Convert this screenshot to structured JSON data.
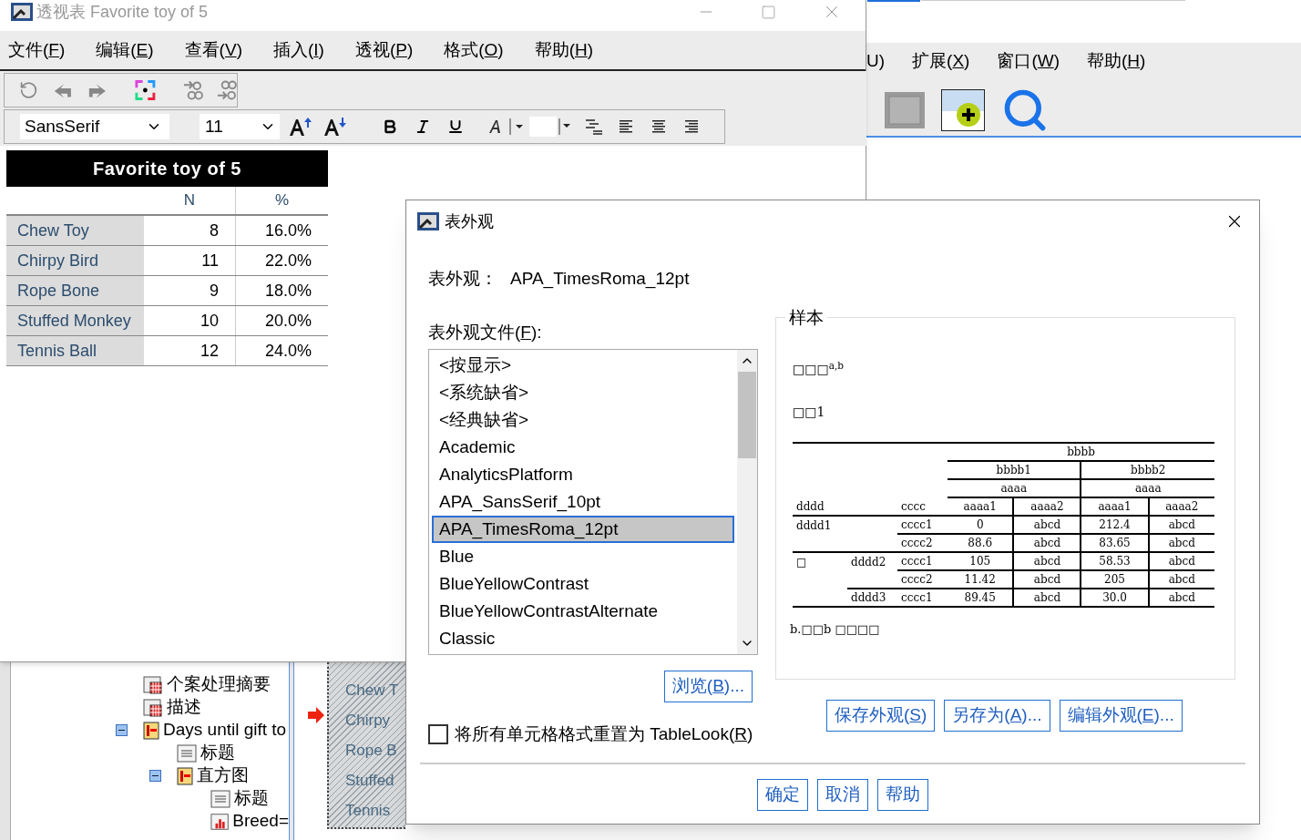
{
  "background_app": {
    "menu": [
      "U)",
      "扩展(X)",
      "窗口(W)",
      "帮助(H)"
    ]
  },
  "outline": {
    "items": [
      {
        "label": "个案处理摘要",
        "kind": "table"
      },
      {
        "label": "描述",
        "kind": "table"
      },
      {
        "label": "Days until gift to",
        "kind": "section",
        "expanded": true,
        "children": [
          {
            "label": "标题",
            "kind": "title"
          },
          {
            "label": "直方图",
            "kind": "section",
            "expanded": true,
            "children": [
              {
                "label": "标题",
                "kind": "title"
              },
              {
                "label": "Breed=",
                "kind": "chart"
              }
            ]
          }
        ]
      }
    ]
  },
  "hatched_preview": [
    "Chew T",
    "Chirpy",
    "Rope B",
    "Stuffed",
    "Tennis"
  ],
  "pivot_window": {
    "title": "透视表 Favorite toy of 5",
    "menu": [
      "文件(F)",
      "编辑(E)",
      "查看(V)",
      "插入(I)",
      "透视(P)",
      "格式(O)",
      "帮助(H)"
    ],
    "font": "SansSerif",
    "font_size": "11",
    "table": {
      "title": "Favorite toy of 5",
      "columns": [
        "N",
        "%"
      ],
      "rows": [
        {
          "label": "Chew Toy",
          "values": [
            "8",
            "16.0%"
          ]
        },
        {
          "label": "Chirpy Bird",
          "values": [
            "11",
            "22.0%"
          ]
        },
        {
          "label": "Rope Bone",
          "values": [
            "9",
            "18.0%"
          ]
        },
        {
          "label": "Stuffed Monkey",
          "values": [
            "10",
            "20.0%"
          ]
        },
        {
          "label": "Tennis Ball",
          "values": [
            "12",
            "24.0%"
          ]
        }
      ]
    }
  },
  "dialog": {
    "title": "表外观",
    "current_label": "表外观：",
    "current_value": "APA_TimesRoma_12pt",
    "files_label": "表外观文件(F):",
    "files": [
      {
        "label": "<按显示>",
        "selected": false
      },
      {
        "label": "<系统缺省>",
        "selected": false
      },
      {
        "label": "<经典缺省>",
        "selected": false
      },
      {
        "label": "Academic",
        "selected": false
      },
      {
        "label": "AnalyticsPlatform",
        "selected": false
      },
      {
        "label": "APA_SansSerif_10pt",
        "selected": false
      },
      {
        "label": "APA_TimesRoma_12pt",
        "selected": true
      },
      {
        "label": "Blue",
        "selected": false
      },
      {
        "label": "BlueYellowContrast",
        "selected": false
      },
      {
        "label": "BlueYellowContrastAlternate",
        "selected": false
      },
      {
        "label": "Classic",
        "selected": false
      }
    ],
    "browse": "浏览(B)...",
    "reset": {
      "label": "将所有单元格格式重置为 TableLook(R)",
      "checked": false
    },
    "sample": {
      "label": "样本",
      "title": "□□□$^{a,b}$",
      "subtitle": "□□1",
      "header_top": "bbbb",
      "header_groups": [
        "bbbb1",
        "bbbb2"
      ],
      "header_sub": [
        "aaaa",
        "aaaa"
      ],
      "row_headers": [
        "dddd",
        "cccc"
      ],
      "columns": [
        "aaaa1",
        "aaaa2",
        "aaaa1",
        "aaaa2"
      ],
      "rows": [
        {
          "level_1": "dddd1",
          "cccc": "cccc1",
          "values": [
            "0",
            "abcd",
            "212.4",
            "abcd"
          ]
        },
        {
          "cccc": "cccc2",
          "values": [
            "88.6",
            "abcd",
            "83.65",
            "abcd"
          ]
        },
        {
          "level_1": "□",
          "level_2": "dddd2",
          "cccc": "cccc1",
          "values": [
            "105",
            "abcd",
            "58.53",
            "abcd"
          ]
        },
        {
          "cccc": "cccc2",
          "values": [
            "11.42",
            "abcd",
            "205",
            "abcd"
          ]
        },
        {
          "level_2": "dddd3",
          "cccc": "cccc1",
          "values": [
            "89.45",
            "abcd",
            "30.0",
            "abcd"
          ]
        }
      ],
      "footnote": "b.□□b □□□□"
    },
    "look_buttons": [
      "保存外观(S)",
      "另存为(A)...",
      "编辑外观(E)..."
    ],
    "buttons": [
      "确定",
      "取消",
      "帮助"
    ]
  }
}
